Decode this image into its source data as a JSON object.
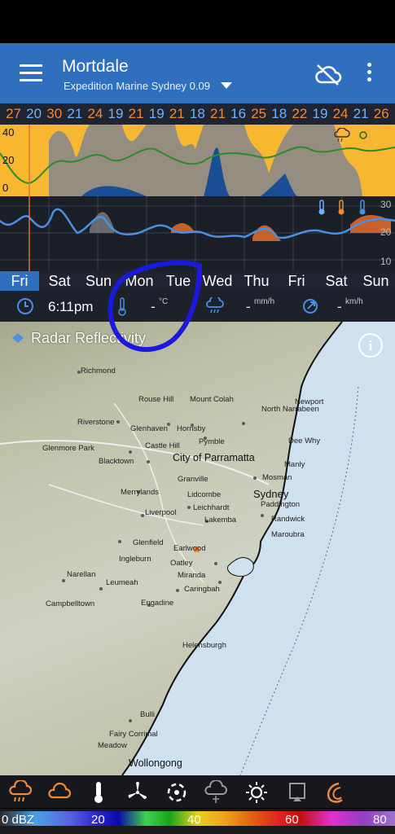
{
  "header": {
    "title": "Mortdale",
    "subtitle": "Expedition Marine Sydney 0.09"
  },
  "temps": [
    "27",
    "20",
    "30",
    "21",
    "24",
    "19",
    "21",
    "19",
    "21",
    "18",
    "21",
    "16",
    "25",
    "18",
    "22",
    "19",
    "24",
    "21",
    "26"
  ],
  "temp_colors": {
    "warm": "#f08a3a",
    "cool": "#6fb4ff"
  },
  "graph1_axis": [
    "40",
    "20",
    "0"
  ],
  "graph2_axis": [
    "30",
    "20",
    "10"
  ],
  "days": [
    {
      "label": "Fri",
      "active": true
    },
    {
      "label": "Sat"
    },
    {
      "label": "Sun"
    },
    {
      "label": "Mon"
    },
    {
      "label": "Tue"
    },
    {
      "label": "Wed"
    },
    {
      "label": "Thu"
    },
    {
      "label": "Fri"
    },
    {
      "label": "Sat"
    },
    {
      "label": "Sun"
    }
  ],
  "info": {
    "time": "6:11pm",
    "temp_value": "-",
    "temp_unit": "°C",
    "rain_value": "-",
    "rain_unit": "mm/h",
    "wind_value": "-",
    "wind_unit": "km/h"
  },
  "map": {
    "layer_label": "Radar Reflectivity",
    "places": [
      {
        "name": "Richmond"
      },
      {
        "name": "Rouse Hill"
      },
      {
        "name": "Mount Colah"
      },
      {
        "name": "Newport"
      },
      {
        "name": "North Narrabeen"
      },
      {
        "name": "Riverstone"
      },
      {
        "name": "Glenhaven"
      },
      {
        "name": "Hornsby"
      },
      {
        "name": "Pymble"
      },
      {
        "name": "Dee Why"
      },
      {
        "name": "Glenmore Park"
      },
      {
        "name": "Blacktown"
      },
      {
        "name": "Castle Hill"
      },
      {
        "name": "City of Parramatta"
      },
      {
        "name": "Manly"
      },
      {
        "name": "Granville"
      },
      {
        "name": "Mosman"
      },
      {
        "name": "Merrylands"
      },
      {
        "name": "Lidcombe"
      },
      {
        "name": "Sydney"
      },
      {
        "name": "Leichhardt"
      },
      {
        "name": "Paddington"
      },
      {
        "name": "Liverpool"
      },
      {
        "name": "Lakemba"
      },
      {
        "name": "Randwick"
      },
      {
        "name": "Maroubra"
      },
      {
        "name": "Glenfield"
      },
      {
        "name": "Earlwood"
      },
      {
        "name": "Ingleburn"
      },
      {
        "name": "Oatley"
      },
      {
        "name": "Narellan"
      },
      {
        "name": "Leumeah"
      },
      {
        "name": "Miranda"
      },
      {
        "name": "Caringbah"
      },
      {
        "name": "Campbelltown"
      },
      {
        "name": "Engadine"
      },
      {
        "name": "Helensburgh"
      },
      {
        "name": "Bulli"
      },
      {
        "name": "Fairy Corrimal"
      },
      {
        "name": "Meadow"
      },
      {
        "name": "Wollongong"
      }
    ]
  },
  "toolbar": {
    "icons": [
      "rain-radar-icon",
      "cloud-icon",
      "thermometer-icon",
      "wind-icon",
      "wind-gust-icon",
      "snow-icon",
      "sun-icon",
      "satellite-icon",
      "lightning-icon"
    ]
  },
  "scale": {
    "labels": [
      "0 dBZ",
      "20",
      "40",
      "60",
      "80"
    ]
  }
}
